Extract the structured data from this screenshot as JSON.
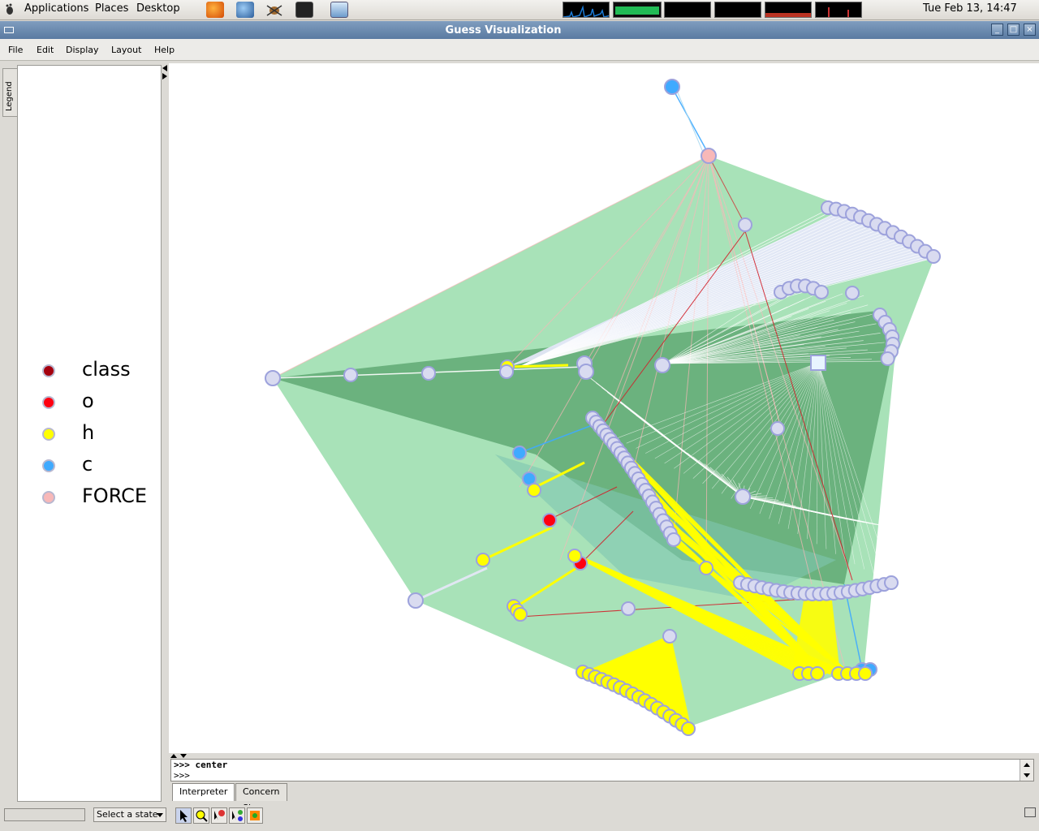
{
  "panel": {
    "menus": [
      "Applications",
      "Places",
      "Desktop"
    ],
    "launchers": [
      "firefox-icon",
      "thunderbird-icon",
      "bug-icon",
      "terminal-icon",
      "remote-desktop-icon"
    ],
    "clock": "Tue Feb 13, 14:47"
  },
  "window": {
    "title": "Guess Visualization",
    "menu": [
      "File",
      "Edit",
      "Display",
      "Layout",
      "Help"
    ]
  },
  "legend": {
    "tab_label": "Legend",
    "items": [
      {
        "label": "class",
        "color": "#a5000e"
      },
      {
        "label": "o",
        "color": "#ff0010"
      },
      {
        "label": "h",
        "color": "#ffff00"
      },
      {
        "label": "c",
        "color": "#3faaff"
      },
      {
        "label": "FORCE",
        "color": "#f8b8b8"
      }
    ]
  },
  "console": {
    "line1": ">>> center",
    "line2": ">>>"
  },
  "tabs": [
    "Interpreter",
    "Concern Sieve"
  ],
  "statusbar": {
    "state_select": "Select a state"
  },
  "colors": {
    "hull_light": "#a3e0b4",
    "hull_dark": "#64ad78",
    "node_default": "#d9dbf0",
    "node_outline": "#9da2dc"
  }
}
